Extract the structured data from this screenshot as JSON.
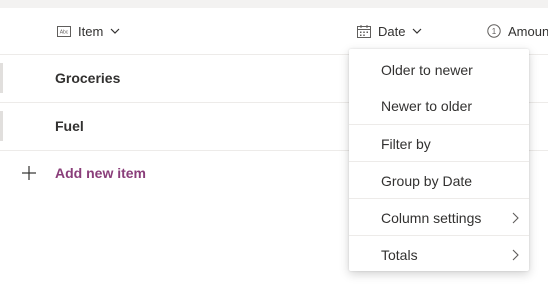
{
  "header": {
    "columns": [
      {
        "label": "Item",
        "icon": "text-column-icon"
      },
      {
        "label": "Date",
        "icon": "calendar-icon"
      },
      {
        "label": "Amoun",
        "icon": "number-column-icon"
      }
    ]
  },
  "rows": [
    {
      "title": "Groceries"
    },
    {
      "title": "Fuel"
    }
  ],
  "add_item": {
    "label": "Add new item",
    "icon": "plus-icon"
  },
  "date_menu": {
    "items": [
      {
        "label": "Older to newer"
      },
      {
        "label": "Newer to older"
      },
      {
        "label": "Filter by"
      },
      {
        "label": "Group by Date"
      },
      {
        "label": "Column settings",
        "has_submenu": true
      },
      {
        "label": "Totals",
        "has_submenu": true
      }
    ]
  },
  "colors": {
    "accent": "#8a3e7a",
    "divider": "#edebe9",
    "text": "#323130"
  }
}
